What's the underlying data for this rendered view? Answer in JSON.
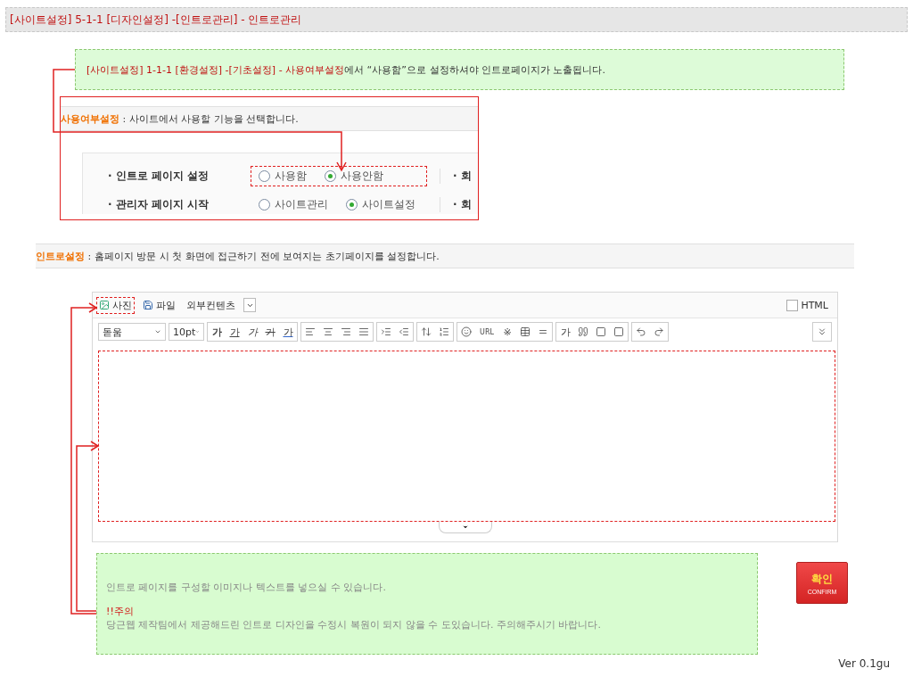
{
  "title_bar": {
    "text": "[사이트설정] 5-1-1 [디자인설정] -[인트로관리] - 인트로관리"
  },
  "notice": {
    "path": "[사이트설정] 1-1-1 [환경설정] -[기초설정] - 사용여부설정",
    "rest": "에서 “사용함”으로 설정하셔야 인트로페이지가 노출됩니다."
  },
  "usage_settings": {
    "title": "사용여부설정",
    "description": " : 사이트에서 사용할 기능을 선택합니다.",
    "rows": [
      {
        "label": "· 인트로 페이지 설정",
        "highlighted": true,
        "options": [
          {
            "label": "사용함",
            "selected": false
          },
          {
            "label": "사용안함",
            "selected": true
          }
        ],
        "column_3": "· 회"
      },
      {
        "label": "· 관리자 페이지 시작",
        "highlighted": false,
        "options": [
          {
            "label": "사이트관리",
            "selected": false
          },
          {
            "label": "사이트설정",
            "selected": true
          }
        ],
        "column_3": "· 회"
      }
    ]
  },
  "intro_settings": {
    "title": "인트로설정",
    "description": " : 홈페이지 방문 시 첫 화면에 접근하기 전에 보여지는 초기페이지를 설정합니다."
  },
  "editor": {
    "attach": [
      {
        "kind": "photo",
        "label": "사진",
        "highlighted": true
      },
      {
        "kind": "file",
        "label": "파일",
        "highlighted": false
      },
      {
        "kind": "text",
        "label": "외부컨텐츠",
        "highlighted": false
      }
    ],
    "html_toggle": {
      "label": "HTML",
      "checked": false
    },
    "font_select": "돋움",
    "size_select": "10pt",
    "format_buttons": [
      {
        "label": "가",
        "kind": "bold"
      },
      {
        "label": "가",
        "kind": "underline"
      },
      {
        "label": "가",
        "kind": "italic"
      },
      {
        "label": "가",
        "kind": "strike"
      },
      {
        "label": "가",
        "kind": "color"
      }
    ],
    "url_button": "URL",
    "symbol_button": "※",
    "char_button": "가"
  },
  "help": {
    "intro": "인트로 페이지를 구성할 이미지나 텍스트를 넣으실 수 있습니다.",
    "warning_title": "!!주의",
    "warning": "당근웹 제작팀에서 제공해드린 인트로 디자인을 수정시 복원이 되지 않을 수 도있습니다. 주의해주시기 바랍니다."
  },
  "confirm_button": {
    "label": "확인",
    "sublabel": "CONFIRM"
  },
  "version": "Ver 0.1gu"
}
